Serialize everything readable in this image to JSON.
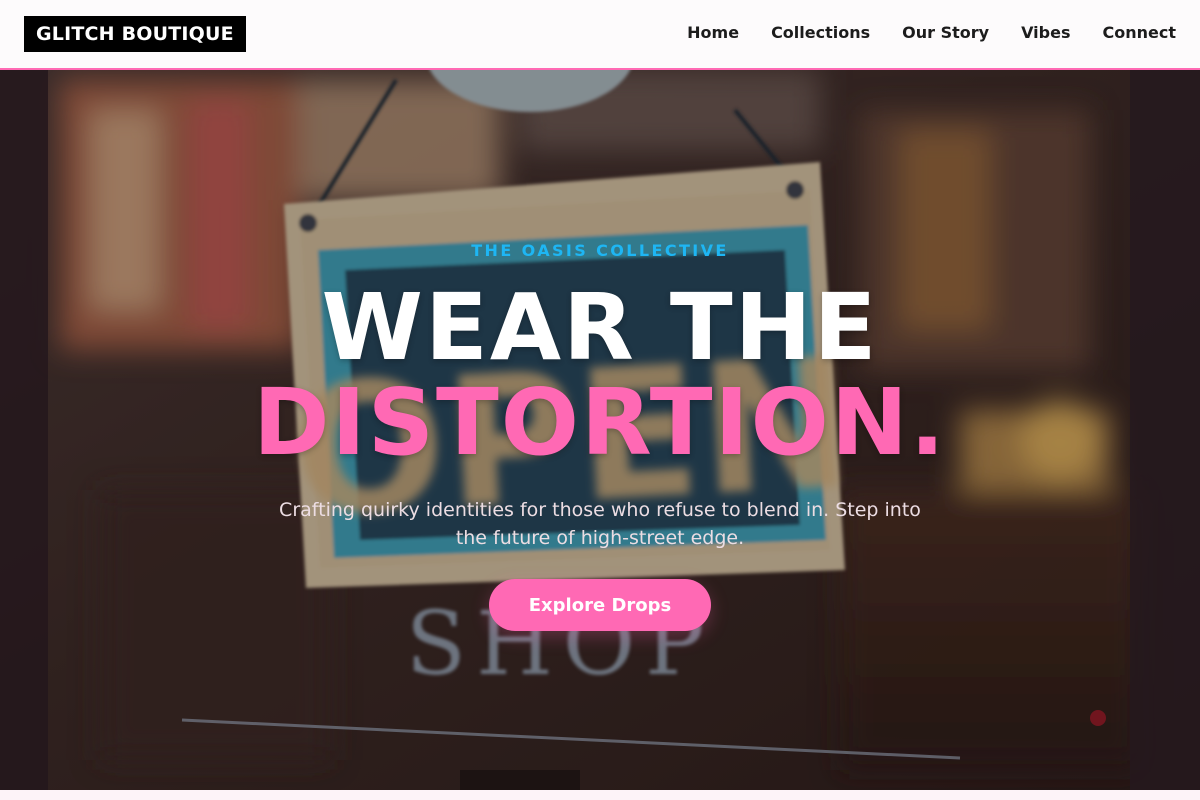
{
  "header": {
    "logo_text": "GLITCH BOUTIQUE",
    "nav": [
      "Home",
      "Collections",
      "Our Story",
      "Vibes",
      "Connect"
    ]
  },
  "hero": {
    "background_image": "blurred shop window with hanging OPEN sign and SHOP lettering",
    "sign_text": "OPEN",
    "window_text": "SHOP",
    "eyebrow": "THE OASIS COLLECTIVE",
    "headline_line1": "WEAR THE",
    "headline_line2": "DISTORTION.",
    "subtitle": "Crafting quirky identities for those who refuse to blend in. Step into the future of high-street edge.",
    "cta_label": "Explore Drops"
  },
  "colors": {
    "accent_pink": "#ff69b4",
    "accent_cyan": "#1eb6f4",
    "header_bg": "#fdfbfc",
    "logo_bg": "#000000"
  }
}
